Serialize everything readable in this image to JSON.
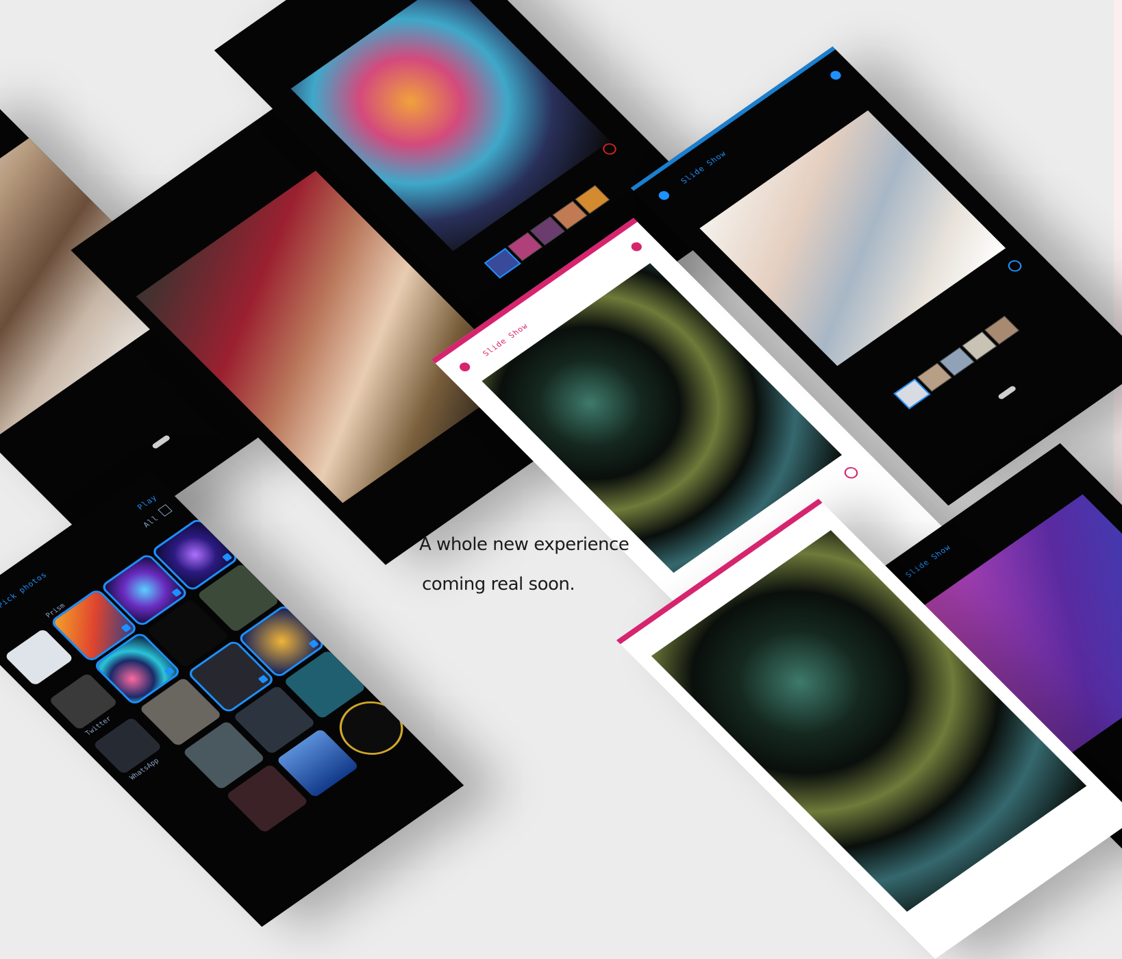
{
  "headline": {
    "line1": "A whole new experience",
    "line2": "coming real soon."
  },
  "slideshow": {
    "title": "Slide Show"
  },
  "picker": {
    "title": "Pick photos",
    "play_label": "Play",
    "all_label": "All",
    "folders": [
      "Prism",
      "Twitter",
      "WhatsApp"
    ]
  },
  "icons": [
    "back-arrow-icon",
    "menu-icon",
    "power-icon",
    "checkbox-icon",
    "info-icon"
  ],
  "colors": {
    "background": "#ececec",
    "accent_blue": "#1e90ff",
    "accent_pink": "#d6246e",
    "phone_dark": "#050505"
  }
}
